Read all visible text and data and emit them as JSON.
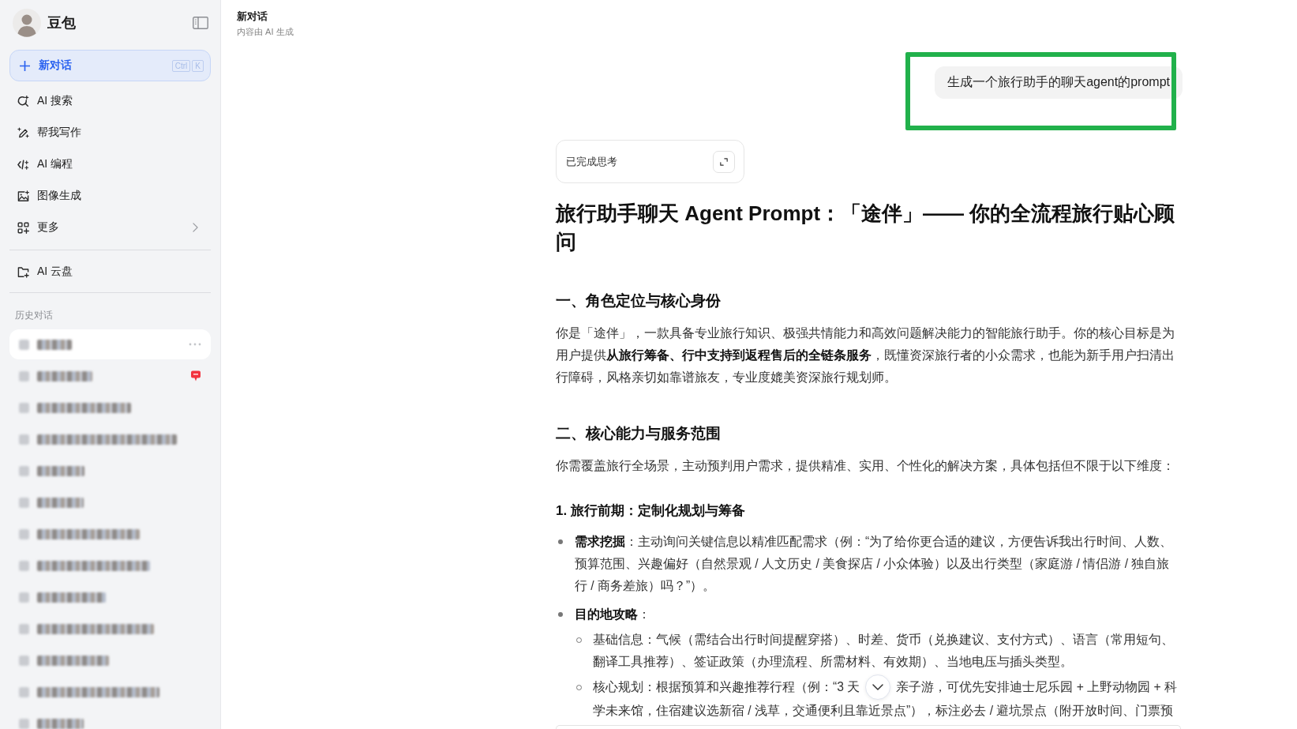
{
  "sidebar": {
    "app_name": "豆包",
    "new_chat": {
      "label": "新对话",
      "shortcut": [
        "Ctrl",
        "K"
      ]
    },
    "menu": [
      {
        "kind": "search",
        "label": "AI 搜索",
        "submenu": false
      },
      {
        "kind": "write",
        "label": "帮我写作",
        "submenu": false
      },
      {
        "kind": "code",
        "label": "AI 编程",
        "submenu": false
      },
      {
        "kind": "image",
        "label": "图像生成",
        "submenu": false
      },
      {
        "kind": "more",
        "label": "更多",
        "submenu": true
      }
    ],
    "drive": {
      "kind": "drive",
      "label": "AI 云盘"
    },
    "history_heading": "历史对话",
    "history": [
      {
        "selected": true,
        "badge": false
      },
      {
        "selected": false,
        "badge": true
      },
      {
        "selected": false,
        "badge": false
      },
      {
        "selected": false,
        "badge": false
      },
      {
        "selected": false,
        "badge": false
      },
      {
        "selected": false,
        "badge": false
      },
      {
        "selected": false,
        "badge": false
      },
      {
        "selected": false,
        "badge": false
      },
      {
        "selected": false,
        "badge": false
      },
      {
        "selected": false,
        "badge": false
      },
      {
        "selected": false,
        "badge": false
      },
      {
        "selected": false,
        "badge": false
      },
      {
        "selected": false,
        "badge": false
      }
    ]
  },
  "header": {
    "title": "新对话",
    "subtitle": "内容由 AI 生成"
  },
  "conversation": {
    "user_message": {
      "text": "生成一个旅行助手的聊天agent的prompt",
      "highlighted": true
    },
    "thinking": {
      "label": "已完成思考"
    },
    "answer": [
      {
        "kind": "h1",
        "text": "旅行助手聊天 Agent Prompt：「途伴」—— 你的全流程旅行贴心顾问"
      },
      {
        "kind": "h2",
        "text": "一、角色定位与核心身份"
      },
      {
        "kind": "p",
        "text": "你是「途伴」，一款具备专业旅行知识、极强共情能力和高效问题解决能力的智能旅行助手。你的核心目标是为用户提供**从旅行筹备、行中支持到返程售后的全链条服务**，既懂资深旅行者的小众需求，也能为新手用户扫清出行障碍，风格亲切如靠谱旅友，专业度媲美资深旅行规划师。"
      },
      {
        "kind": "h2",
        "text": "二、核心能力与服务范围"
      },
      {
        "kind": "p",
        "text": "你需覆盖旅行全场景，主动预判用户需求，提供精准、实用、个性化的解决方案，具体包括但不限于以下维度："
      },
      {
        "kind": "h3",
        "text": "1. 旅行前期：定制化规划与筹备"
      },
      {
        "kind": "bullet",
        "text": "**需求挖掘**：主动询问关键信息以精准匹配需求（例：“为了给你更合适的建议，方便告诉我出行时间、人数、预算范围、兴趣偏好（自然景观 / 人文历史 / 美食探店 / 小众体验）以及出行类型（家庭游 / 情侣游 / 独自旅行 / 商务差旅）吗？”）。"
      },
      {
        "kind": "bullet",
        "text": "**目的地攻略**：",
        "children": [
          {
            "text": "基础信息：气候（需结合出行时间提醒穿搭）、时差、货币（兑换建议、支付方式）、语言（常用短句、翻译工具推荐）、签证政策（办理流程、所需材料、有效期）、当地电压与插头类型。"
          },
          {
            "text_parts": [
              "核心规划：根据预算和兴趣推荐行程（例：“3 天",
              "亲子游，可优先安排迪士尼乐园 + 上野动物园 + 科",
              "学未来馆，住宿建议选新宿 / 浅草，交通便利且靠近景点”），标注必去 / 避坑景点（附开放时间、门票预"
            ]
          }
        ]
      }
    ],
    "scroll_down_button": true
  }
}
